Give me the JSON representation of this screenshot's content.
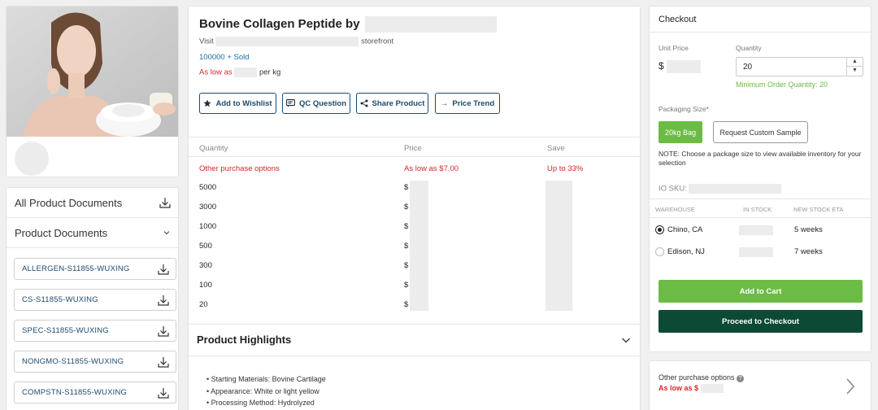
{
  "product": {
    "title": "Bovine Collagen Peptide by",
    "visit_prefix": "Visit",
    "visit_suffix": "storefront",
    "sold": "100000 + Sold",
    "as_low_as": "As low as",
    "per_kg": "per kg"
  },
  "actions": {
    "wishlist": "Add to Wishlist",
    "qc": "QC Question",
    "share": "Share Product",
    "trend": "Price Trend"
  },
  "price_table": {
    "headers": [
      "Quantity",
      "Price",
      "Save"
    ],
    "other": {
      "label": "Other purchase options",
      "price": "As low as $7.00",
      "save": "Up to 33%"
    },
    "rows": [
      {
        "qty": "5000",
        "price": "$"
      },
      {
        "qty": "3000",
        "price": "$"
      },
      {
        "qty": "1000",
        "price": "$"
      },
      {
        "qty": "500",
        "price": "$"
      },
      {
        "qty": "300",
        "price": "$"
      },
      {
        "qty": "100",
        "price": "$"
      },
      {
        "qty": "20",
        "price": "$"
      }
    ]
  },
  "highlights": {
    "title": "Product Highlights",
    "items": [
      "Starting Materials: Bovine Cartilage",
      "Appearance: White or light yellow",
      "Processing Method: Hydrolyzed"
    ]
  },
  "docs": {
    "all_title": "All Product Documents",
    "section_title": "Product Documents",
    "items": [
      "ALLERGEN-S11855-WUXING",
      "CS-S11855-WUXING",
      "SPEC-S11855-WUXING",
      "NONGMO-S11855-WUXING",
      "COMPSTN-S11855-WUXING"
    ]
  },
  "checkout": {
    "title": "Checkout",
    "unit_price_label": "Unit Price",
    "unit_price_symbol": "$",
    "quantity_label": "Quantity",
    "quantity_value": "20",
    "min_order": "Minimum Order Quantity: 20",
    "packaging_label": "Packaging Size*",
    "package_selected": "20kg Bag",
    "request_sample": "Request Custom Sample",
    "note": "NOTE: Choose a package size to view available inventory for your selection",
    "sku_label": "IO SKU:",
    "wh_headers": [
      "WAREHOUSE",
      "IN STOCK",
      "NEW STOCK ETA"
    ],
    "warehouses": [
      {
        "name": "Chino, CA",
        "eta": "5 weeks",
        "selected": true
      },
      {
        "name": "Edison, NJ",
        "eta": "7 weeks",
        "selected": false
      }
    ],
    "add_to_cart": "Add to Cart",
    "proceed": "Proceed to Checkout"
  },
  "other_options": {
    "title": "Other purchase options",
    "price": "As low as $"
  },
  "colors": {
    "brand_navy": "#1c4a6e",
    "green": "#6cbb45",
    "dark_green": "#0d4a35",
    "red": "#d9252a"
  }
}
